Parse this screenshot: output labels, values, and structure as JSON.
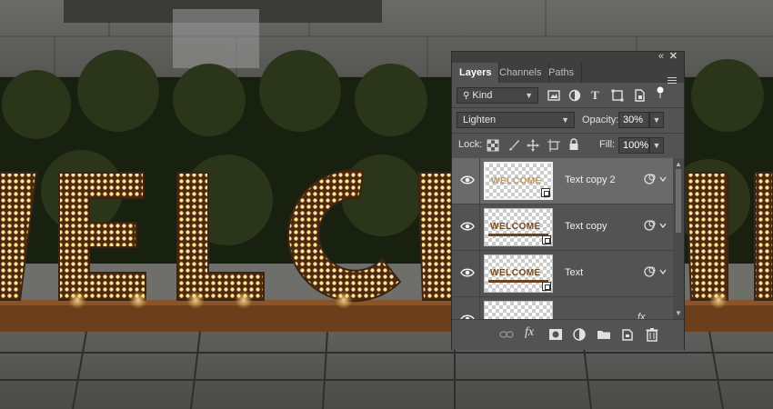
{
  "panel": {
    "tabs": [
      "Layers",
      "Channels",
      "Paths"
    ],
    "active_tab": "Layers",
    "filter": {
      "kind_label": "Kind",
      "icons": [
        "image-filter-icon",
        "adjustment-filter-icon",
        "type-filter-icon",
        "shape-filter-icon",
        "smart-object-filter-icon",
        "filter-toggle-icon"
      ]
    },
    "blend": {
      "mode": "Lighten",
      "opacity_label": "Opacity:",
      "opacity_value": "30%"
    },
    "lock": {
      "label": "Lock:",
      "icons": [
        "lock-transparent-icon",
        "lock-paint-icon",
        "lock-position-icon",
        "lock-artboard-icon",
        "lock-all-icon"
      ],
      "fill_label": "Fill:",
      "fill_value": "100%"
    },
    "layers": [
      {
        "name": "Text copy 2",
        "thumb_text": "WELCOME",
        "selected": true
      },
      {
        "name": "Text copy",
        "thumb_text": "WELCOME",
        "selected": false
      },
      {
        "name": "Text",
        "thumb_text": "WELCOME",
        "selected": false
      },
      {
        "name": "",
        "thumb_text": "",
        "selected": false,
        "fx": "fx"
      }
    ],
    "bottom_icons": [
      "link-layers-icon",
      "fx-icon",
      "add-mask-icon",
      "adjustment-layer-icon",
      "new-group-icon",
      "new-layer-icon",
      "delete-layer-icon"
    ],
    "fx_label": "fx"
  },
  "canvas": {
    "sign_text": "WELCOME",
    "colors": {
      "wood": "#6b3f1c",
      "bulb": "#ffd27a",
      "letter": "#3d2412"
    }
  }
}
